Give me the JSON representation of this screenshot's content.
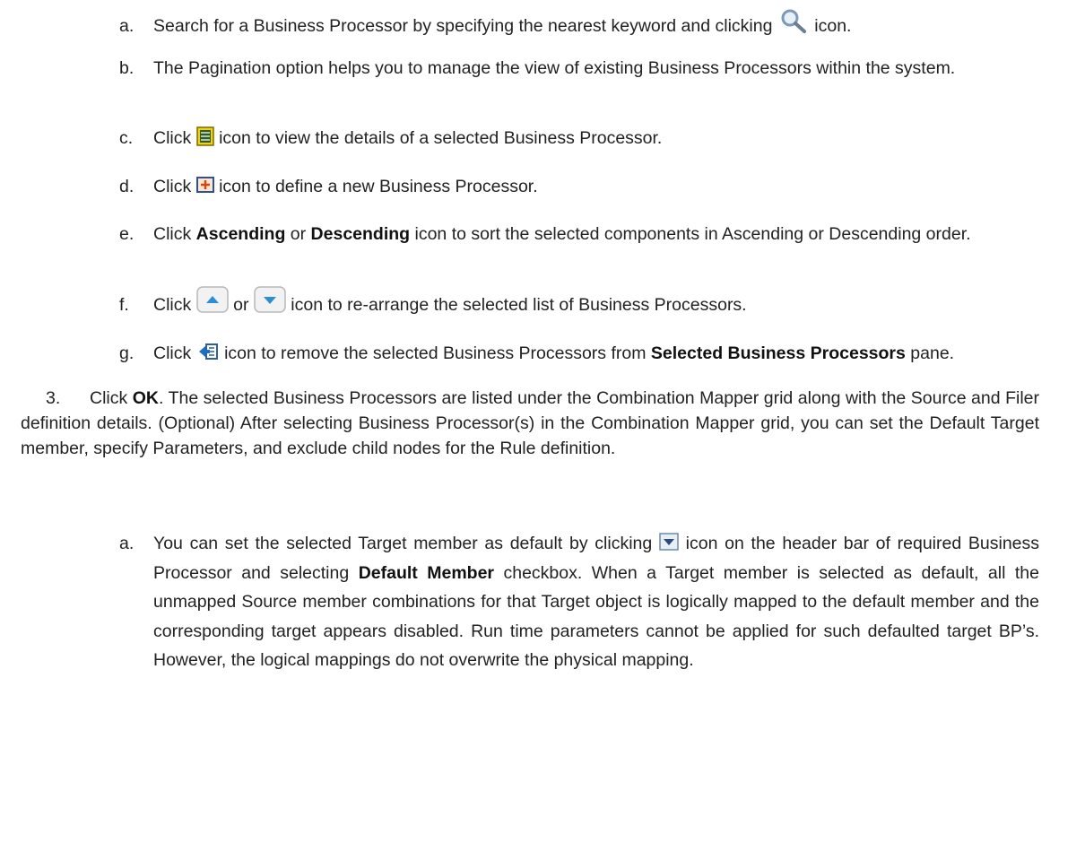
{
  "list_a": {
    "a": {
      "marker": "a.",
      "before": "Search for a Business Processor by specifying the nearest keyword and clicking",
      "after": "icon."
    },
    "b": {
      "marker": "b.",
      "text": "The Pagination option helps you to manage the view of existing Business Processors within the system."
    },
    "c": {
      "marker": "c.",
      "before": "Click",
      "after": "icon to view the details of a selected Business Processor."
    },
    "d": {
      "marker": "d.",
      "before": "Click",
      "after": "icon to define a new Business Processor."
    },
    "e": {
      "marker": "e.",
      "before": "Click",
      "bold1": "Ascending",
      "mid": "or",
      "bold2": "Descending",
      "after": "icon to sort the selected components in Ascending or Descending order."
    },
    "f": {
      "marker": "f.",
      "before": "Click",
      "mid": "or",
      "after": "icon to re-arrange the selected list of Business Processors."
    },
    "g": {
      "marker": "g.",
      "before": "Click",
      "after": "icon to remove the selected Business Processors from",
      "bold": "Selected Business Processors",
      "end": "pane."
    }
  },
  "step3": {
    "marker": "3.",
    "before": "Click",
    "bold": "OK",
    "after": ". The selected Business Processors are listed under the Combination Mapper grid along with the Source and Filer definition details. (Optional) After selecting Business Processor(s) in the Combination Mapper grid, you can set the Default Target member, specify Parameters, and exclude child nodes for the Rule definition."
  },
  "list_b": {
    "a": {
      "marker": "a.",
      "before": "You can set the selected Target member as default by clicking",
      "mid": "icon on the header bar of required Business Processor and selecting",
      "bold": "Default Member",
      "after": "checkbox. When a Target member is selected as default, all the unmapped Source member combinations for that Target object is logically mapped to the default member and the corresponding target appears disabled. Run time parameters cannot be applied for such defaulted target BP’s. However, the logical mappings do not overwrite the physical mapping."
    }
  }
}
